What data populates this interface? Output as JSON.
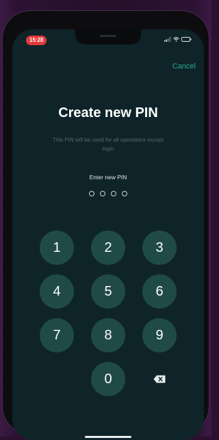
{
  "status_bar": {
    "time": "15:28",
    "icons": [
      "signal-icon",
      "wifi-icon",
      "battery-icon"
    ]
  },
  "header": {
    "cancel_label": "Cancel"
  },
  "main": {
    "title": "Create new PIN",
    "subtitle": "This PIN will be used for all operations except login",
    "pin_label": "Enter new PIN",
    "pin_length": 4,
    "pin_entered": 0
  },
  "keypad": {
    "keys": [
      "1",
      "2",
      "3",
      "4",
      "5",
      "6",
      "7",
      "8",
      "9",
      "0"
    ],
    "backspace_icon": "backspace-icon"
  },
  "colors": {
    "background": "#0f2429",
    "key": "#1f4a48",
    "accent": "#2aa58f",
    "time_pill": "#e23a3a"
  }
}
